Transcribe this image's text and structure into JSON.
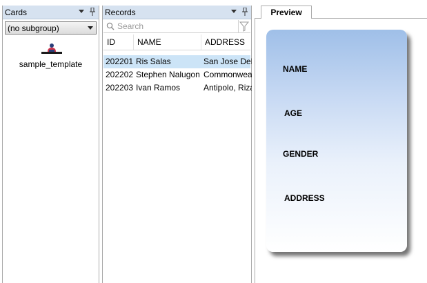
{
  "cards_panel": {
    "title": "Cards",
    "subgroup_selected": "(no subgroup)",
    "template_label": "sample_template"
  },
  "records_panel": {
    "title": "Records",
    "search_placeholder": "Search",
    "columns": [
      "ID",
      "NAME",
      "ADDRESS"
    ],
    "rows": [
      {
        "id": "202201",
        "name": "Ris Salas",
        "address": "San Jose Del",
        "selected": true
      },
      {
        "id": "202202",
        "name": "Stephen Nalugon",
        "address": "Commonwea"
      },
      {
        "id": "202203",
        "name": "Ivan Ramos",
        "address": "Antipolo, Riza"
      }
    ]
  },
  "preview": {
    "tab_label": "Preview",
    "fields": [
      "NAME",
      "AGE",
      "GENDER",
      "ADDRESS"
    ]
  },
  "colors": {
    "header_bg": "#d6e2f0",
    "selected_row": "#cce4f7",
    "card_top": "#9fbfe8"
  },
  "icons": {
    "dropdown": "chevron-down-icon",
    "pin": "pin-icon",
    "search": "search-icon",
    "filter": "filter-icon",
    "template": "id-card-template-icon"
  }
}
